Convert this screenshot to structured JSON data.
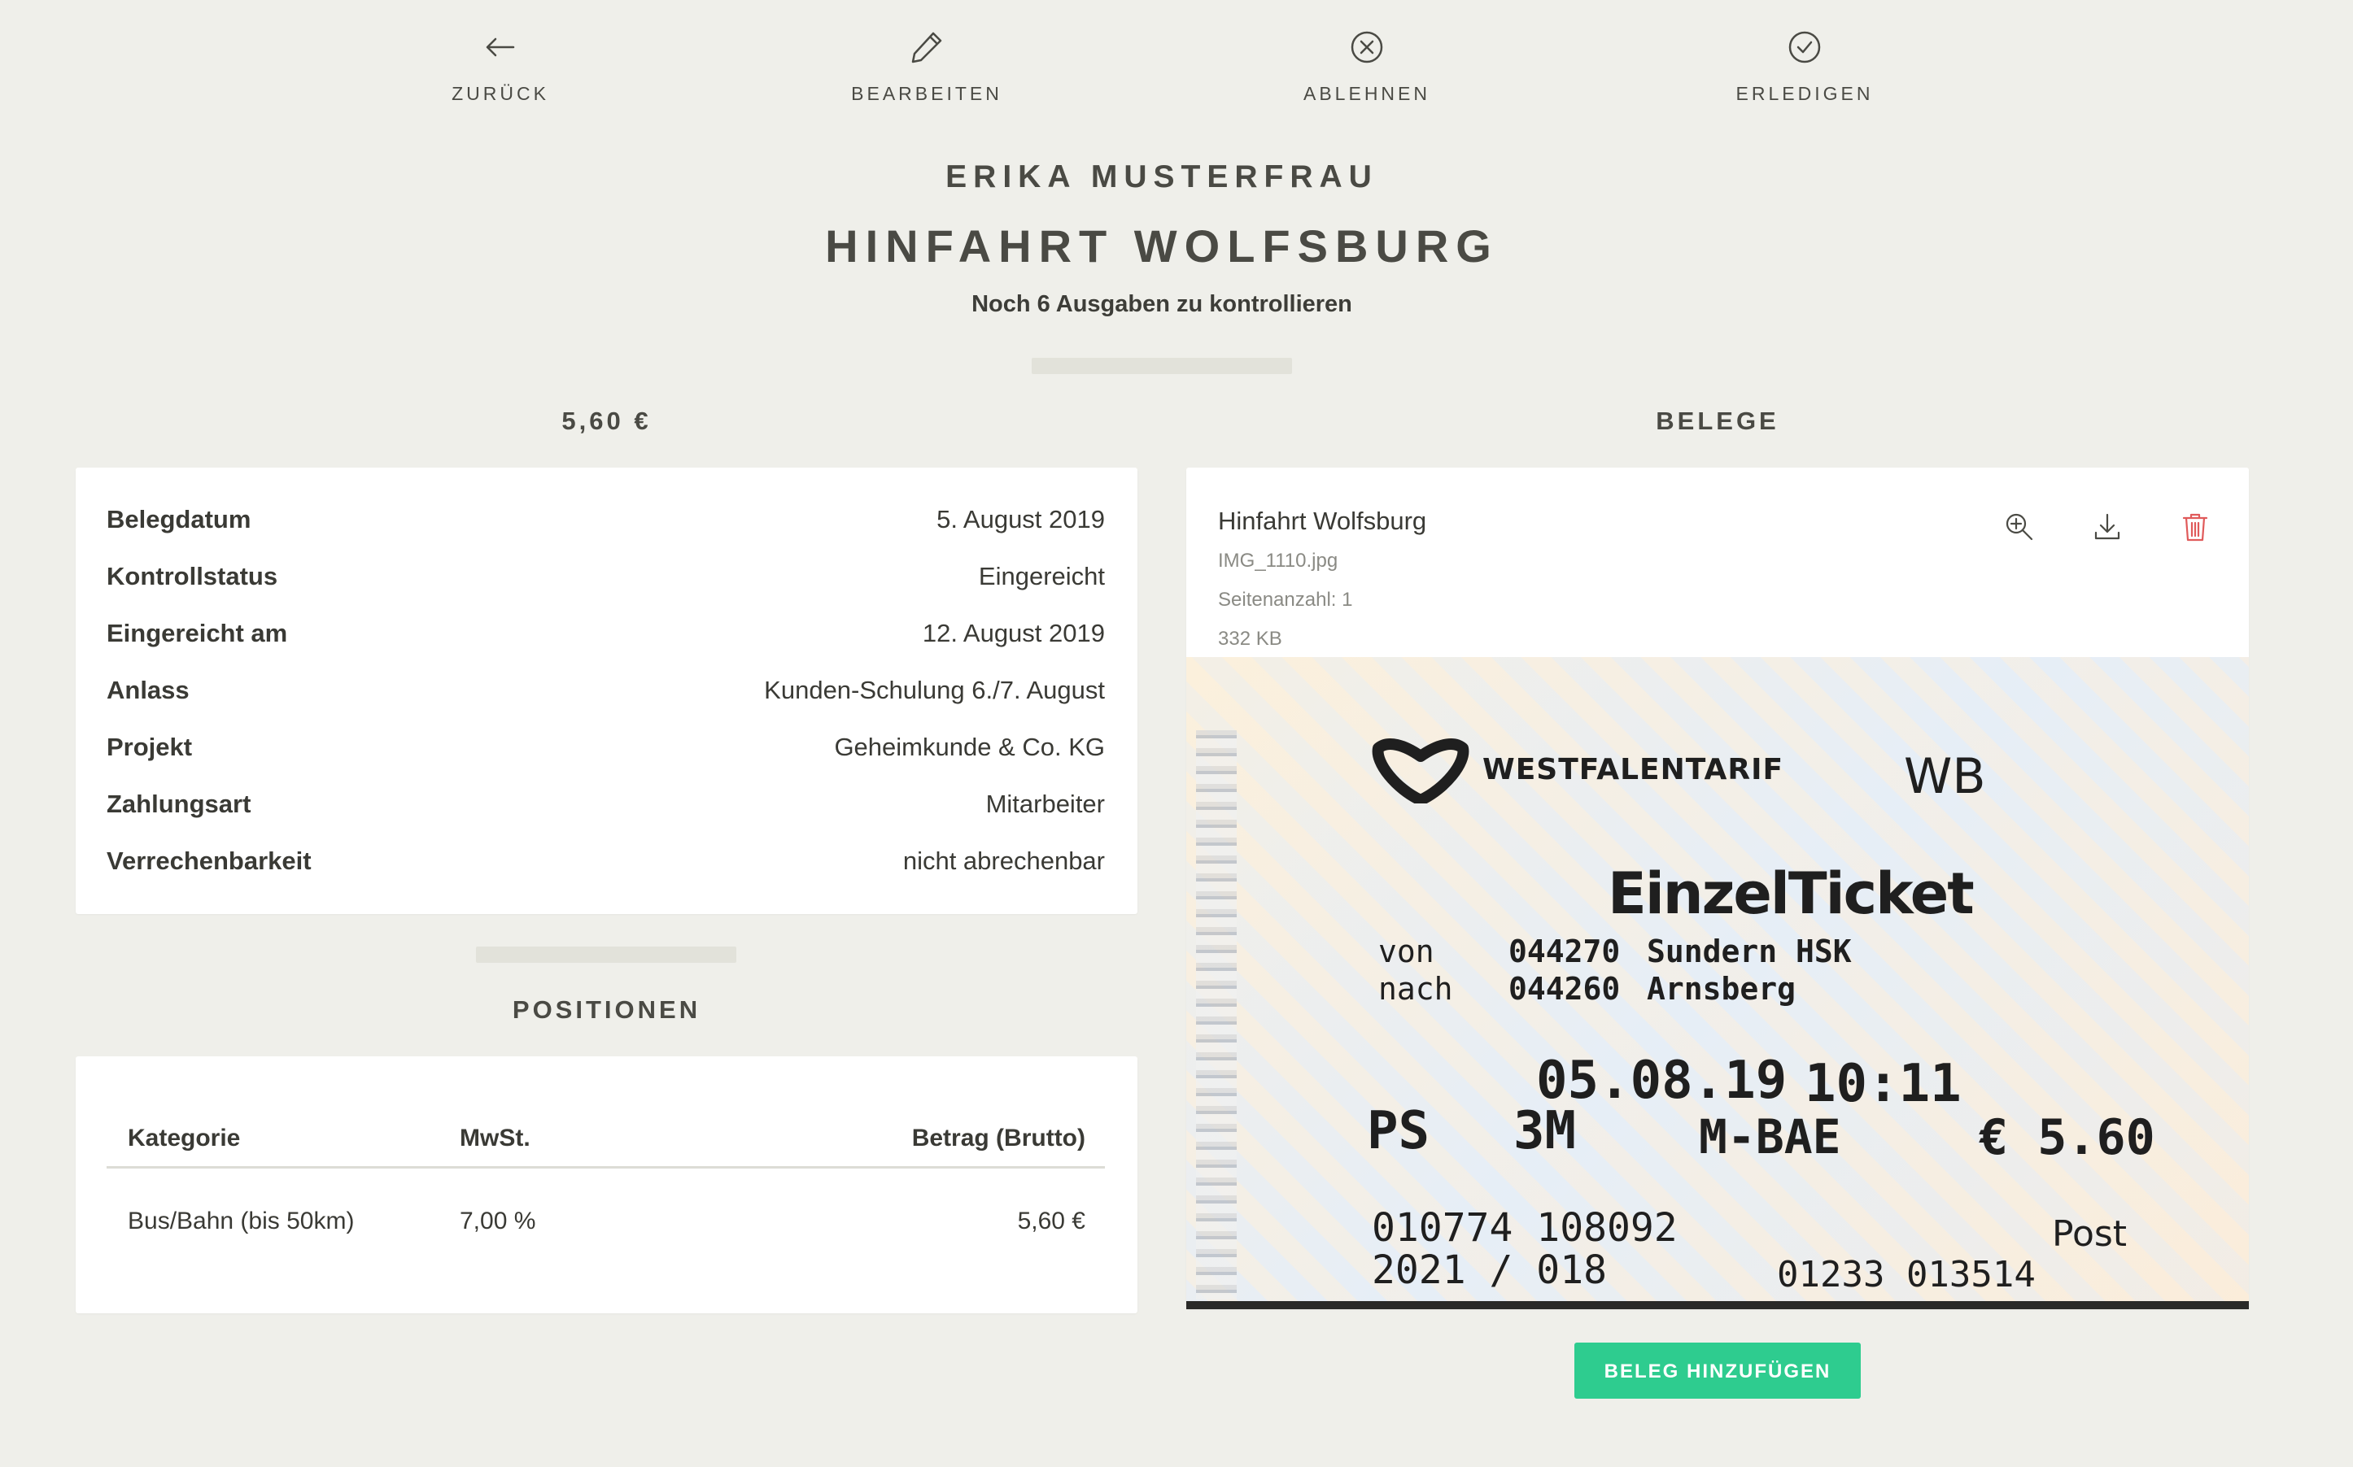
{
  "toolbar": {
    "back": "ZURÜCK",
    "edit": "BEARBEITEN",
    "reject": "ABLEHNEN",
    "done": "ERLEDIGEN"
  },
  "header": {
    "person": "ERIKA MUSTERFRAU",
    "title": "HINFAHRT WOLFSBURG",
    "subtitle": "Noch 6 Ausgaben zu kontrollieren"
  },
  "amount_heading": "5,60 €",
  "details": [
    {
      "label": "Belegdatum",
      "value": "5. August 2019"
    },
    {
      "label": "Kontrollstatus",
      "value": "Eingereicht"
    },
    {
      "label": "Eingereicht am",
      "value": "12. August 2019"
    },
    {
      "label": "Anlass",
      "value": "Kunden-Schulung 6./7. August"
    },
    {
      "label": "Projekt",
      "value": "Geheimkunde & Co. KG"
    },
    {
      "label": "Zahlungsart",
      "value": "Mitarbeiter"
    },
    {
      "label": "Verrechenbarkeit",
      "value": "nicht abrechenbar"
    }
  ],
  "positions": {
    "heading": "POSITIONEN",
    "columns": [
      "Kategorie",
      "MwSt.",
      "Betrag (Brutto)"
    ],
    "rows": [
      [
        "Bus/Bahn (bis 50km)",
        "7,00 %",
        "5,60 €"
      ]
    ]
  },
  "receipts": {
    "heading": "BELEGE",
    "item": {
      "title": "Hinfahrt Wolfsburg",
      "filename": "IMG_1110.jpg",
      "pages": "Seitenanzahl: 1",
      "size": "332 KB"
    },
    "add_button": "BELEG HINZUFÜGEN"
  },
  "ticket": {
    "brand": "WESTFALENTARIF",
    "zone": "WB",
    "type": "EinzelTicket",
    "from_label": "von",
    "to_label": "nach",
    "from_code": "044270",
    "to_code": "044260",
    "from_name": "Sundern HSK",
    "to_name": "Arnsberg",
    "date": "05.08.19",
    "time": "10:11",
    "ps": "PS",
    "class": "3M",
    "code": "M-BAE",
    "price": "€ 5.60",
    "serial1": "010774 108092",
    "serial2": "2021 / 018",
    "post": "Post",
    "serial3": "01233 013514"
  },
  "colors": {
    "background": "#efefea",
    "accent": "#2ecc8f",
    "danger": "#e05a5a",
    "text": "#4a4a44"
  },
  "icons": [
    "arrow-left-icon",
    "pencil-icon",
    "circle-x-icon",
    "circle-check-icon",
    "zoom-in-icon",
    "download-icon",
    "trash-icon"
  ]
}
